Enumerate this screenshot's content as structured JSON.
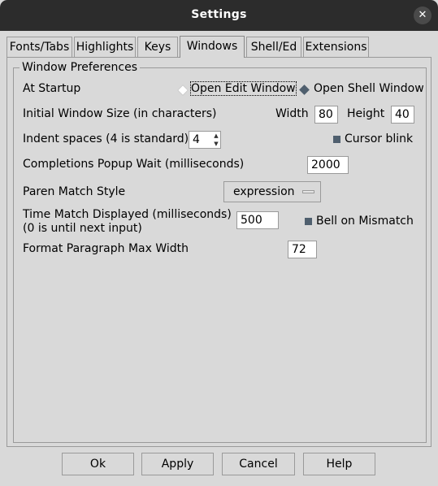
{
  "window": {
    "title": "Settings",
    "close_glyph": "✕"
  },
  "tabs": [
    {
      "label": "Fonts/Tabs"
    },
    {
      "label": "Highlights"
    },
    {
      "label": "Keys"
    },
    {
      "label": "Windows",
      "active": true
    },
    {
      "label": "Shell/Ed"
    },
    {
      "label": "Extensions"
    }
  ],
  "window_prefs": {
    "legend": "Window Preferences",
    "startup_label": "At Startup",
    "startup_options": [
      "Open Edit Window",
      "Open Shell Window"
    ],
    "startup_selected": "Open Shell Window",
    "size_label": "Initial Window Size  (in characters)",
    "width_label": "Width",
    "width_value": "80",
    "height_label": "Height",
    "height_value": "40",
    "indent_label": "Indent spaces (4 is standard)",
    "indent_value": "4",
    "cursor_blink_label": "Cursor blink",
    "cursor_blink_checked": true,
    "completions_label": "Completions Popup Wait (milliseconds)",
    "completions_value": "2000",
    "paren_label": "Paren Match Style",
    "paren_value": "expression",
    "time_match_label_1": "Time Match Displayed (milliseconds)",
    "time_match_label_2": "(0 is until next input)",
    "time_match_value": "500",
    "bell_label": "Bell on Mismatch",
    "bell_checked": true,
    "format_label": "Format Paragraph Max Width",
    "format_value": "72"
  },
  "buttons": {
    "ok": "Ok",
    "apply": "Apply",
    "cancel": "Cancel",
    "help": "Help"
  },
  "colors": {
    "titlebar": "#2c2c2c",
    "background": "#d9d9d9",
    "indicator": "#4f5f6e"
  }
}
